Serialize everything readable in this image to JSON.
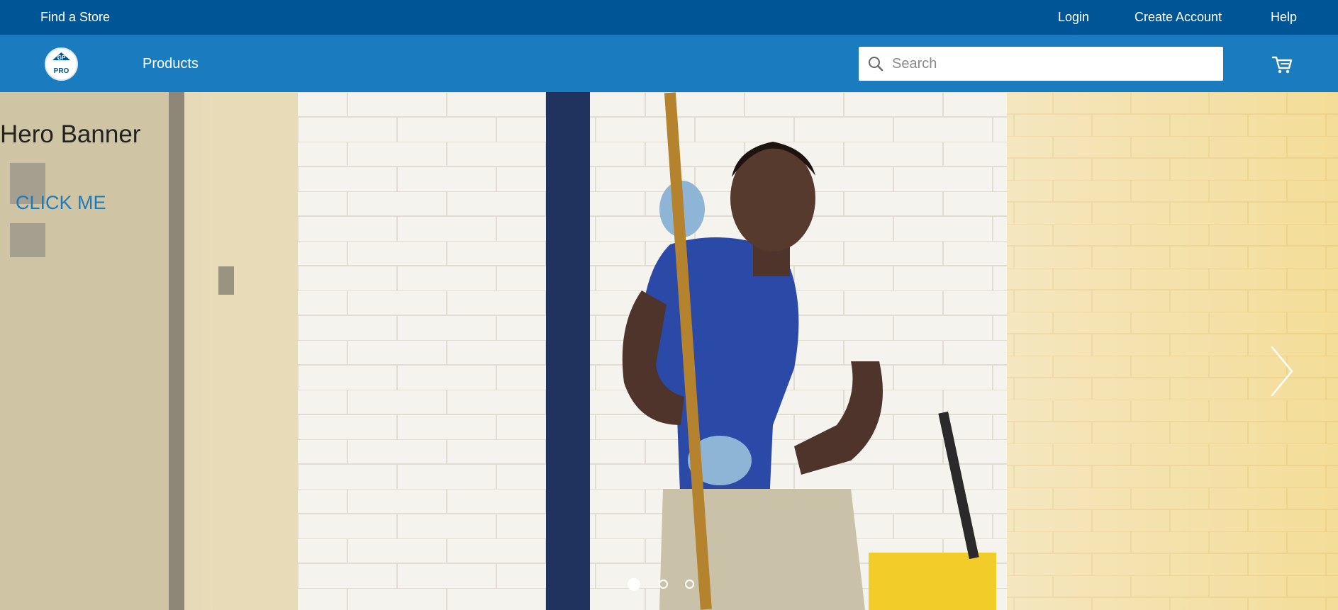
{
  "topbar": {
    "find_store": "Find a Store",
    "login": "Login",
    "create_account": "Create Account",
    "help": "Help",
    "color": "#005596"
  },
  "navbar": {
    "logo_text_top": "GP",
    "logo_text_bottom": "PRO",
    "products": "Products",
    "search_placeholder": "Search",
    "cart_icon": "cart-icon",
    "color": "#1a7bbf"
  },
  "hero": {
    "title": "Hero Banner",
    "cta": "CLICK ME",
    "next_icon": "chevron-right-icon",
    "slides": 3,
    "active_slide": 1
  }
}
